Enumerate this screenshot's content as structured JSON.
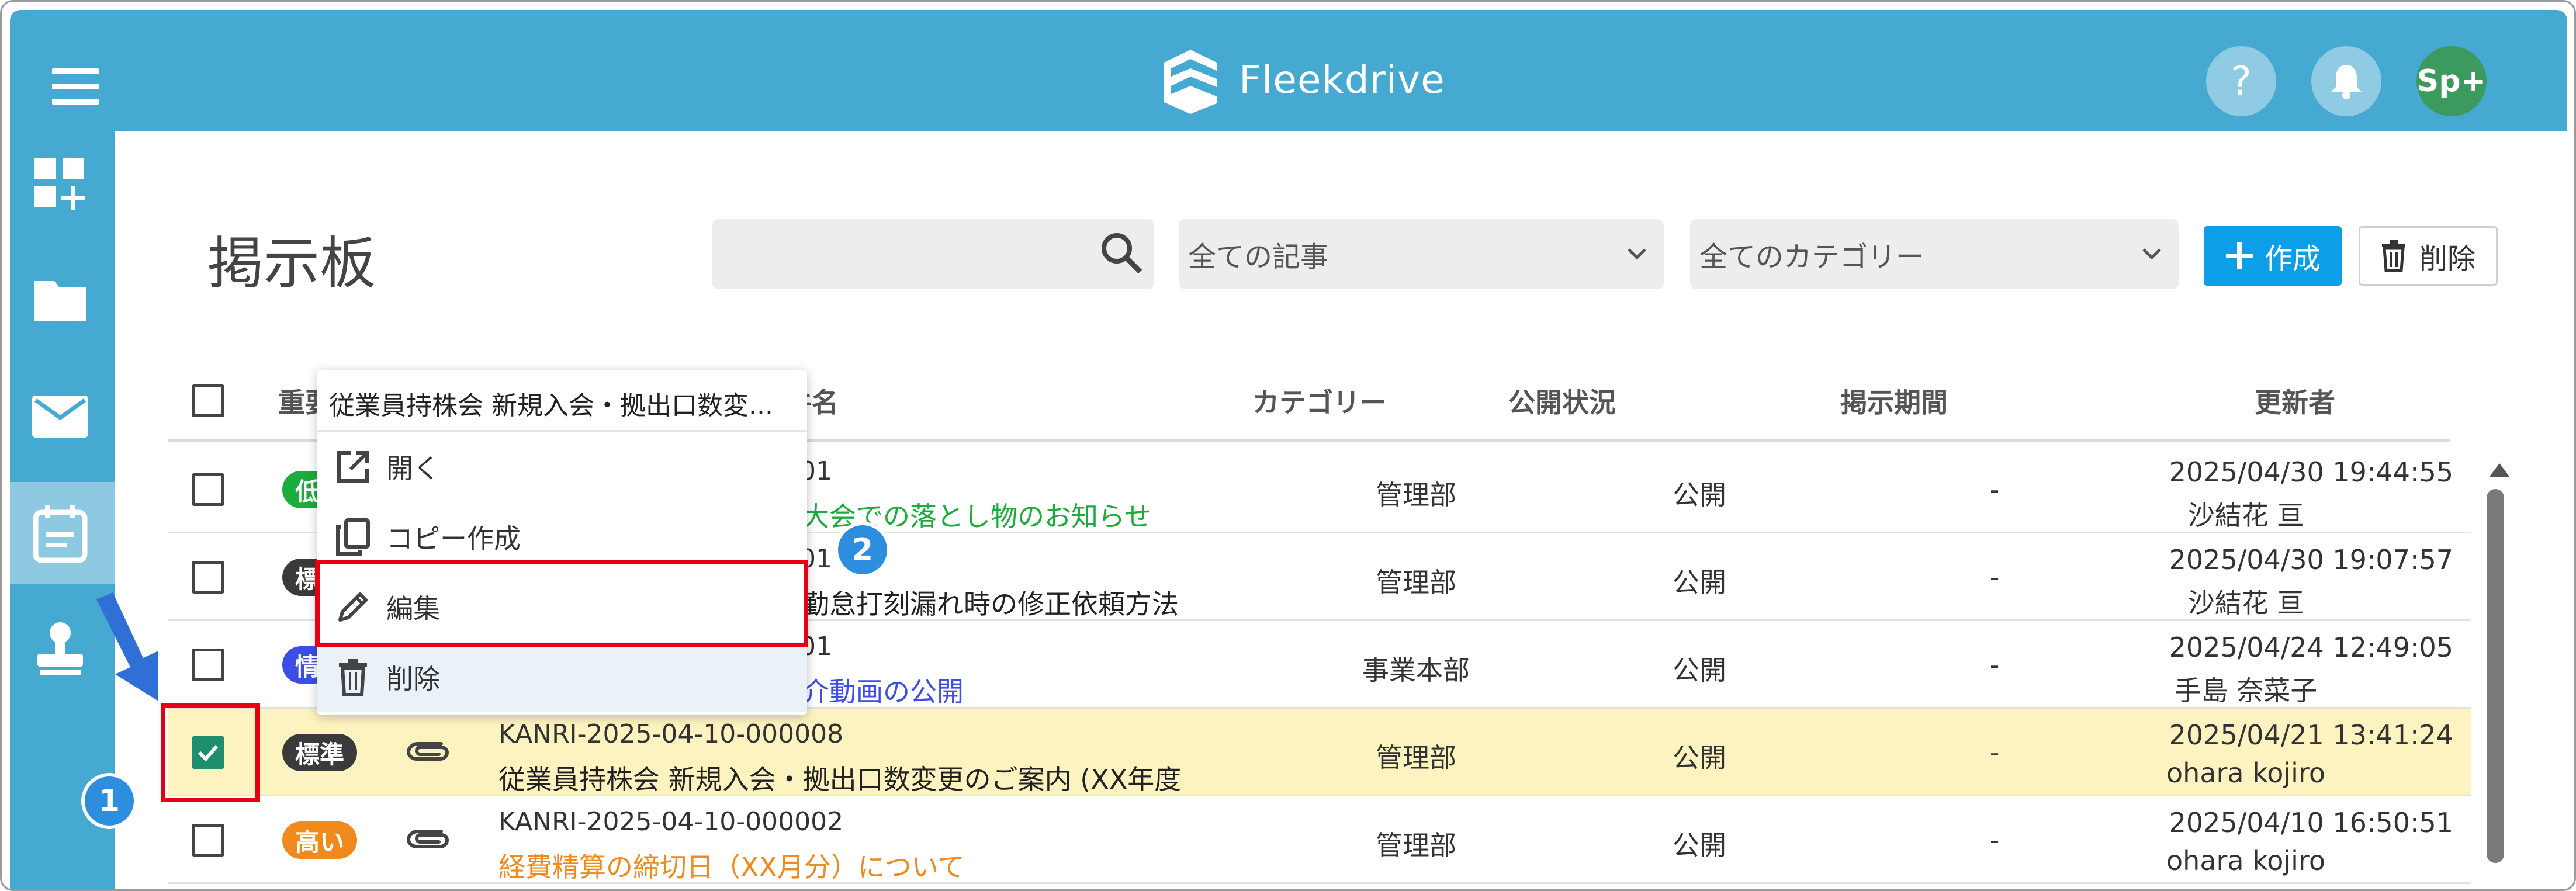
{
  "app": {
    "name": "Fleekdrive",
    "avatar_label": "Sp+",
    "help_label": "?"
  },
  "colors": {
    "primary": "#45a9d2",
    "create_button": "#0d9ee8",
    "highlight_red": "#e60012",
    "selected_row": "#fcf3c0",
    "step_badge": "#2d8ee0"
  },
  "sidebar": {
    "items": [
      {
        "icon": "dashboard-add-icon"
      },
      {
        "icon": "folder-icon"
      },
      {
        "icon": "mail-icon"
      },
      {
        "icon": "bulletin-board-icon",
        "active": true
      },
      {
        "icon": "stamp-icon"
      }
    ]
  },
  "page": {
    "title": "掲示板"
  },
  "toolbar": {
    "search_placeholder": "",
    "article_filter": "全ての記事",
    "category_filter": "全てのカテゴリー",
    "create_label": "作成",
    "delete_label": "削除"
  },
  "table": {
    "headers": {
      "importance": "重要",
      "subject": "件名",
      "category": "カテゴリー",
      "status": "公開状況",
      "period": "掲示期間",
      "updater": "更新者"
    },
    "rows": [
      {
        "importance": "低",
        "importance_color": "#1aad3b",
        "code": "01",
        "subject": "大会での落とし物のお知らせ",
        "subject_color": "#1aad3b",
        "category": "管理部",
        "status": "公開",
        "period": "-",
        "updated": "2025/04/30 19:44:55",
        "user": "沙結花 亘",
        "checked": false,
        "attachment": false
      },
      {
        "importance": "標",
        "importance_color": "#3a3a3a",
        "code": "01",
        "subject": "勤怠打刻漏れ時の修正依頼方法",
        "subject_color": "#222222",
        "category": "管理部",
        "status": "公開",
        "period": "-",
        "updated": "2025/04/30 19:07:57",
        "user": "沙結花 亘",
        "checked": false,
        "attachment": false
      },
      {
        "importance": "情",
        "importance_color": "#3d4ee8",
        "code": "01",
        "subject": "介動画の公開",
        "subject_color": "#3d4ee8",
        "category": "事業本部",
        "status": "公開",
        "period": "-",
        "updated": "2025/04/24 12:49:05",
        "user": "手島 奈菜子",
        "checked": false,
        "attachment": false
      },
      {
        "importance": "標準",
        "importance_color": "#3a3a3a",
        "code": "KANRI-2025-04-10-000008",
        "subject": "従業員持株会 新規入会・拠出口数変更のご案内 (XX年度",
        "subject_color": "#222222",
        "category": "管理部",
        "status": "公開",
        "period": "-",
        "updated": "2025/04/21 13:41:24",
        "user": "ohara kojiro",
        "checked": true,
        "attachment": true
      },
      {
        "importance": "高い",
        "importance_color": "#f08a1c",
        "code": "KANRI-2025-04-10-000002",
        "subject": "経費精算の締切日（XX月分）について",
        "subject_color": "#f08a1c",
        "category": "管理部",
        "status": "公開",
        "period": "-",
        "updated": "2025/04/10 16:50:51",
        "user": "ohara kojiro",
        "checked": false,
        "attachment": true
      }
    ]
  },
  "context_menu": {
    "title": "従業員持株会 新規入会・拠出口数変...",
    "items": [
      {
        "label": "開く",
        "icon": "open-external-icon"
      },
      {
        "label": "コピー作成",
        "icon": "copy-icon"
      },
      {
        "label": "編集",
        "icon": "pencil-icon"
      },
      {
        "label": "削除",
        "icon": "trash-icon"
      }
    ]
  },
  "annotations": {
    "step1": "1",
    "step2": "2"
  }
}
